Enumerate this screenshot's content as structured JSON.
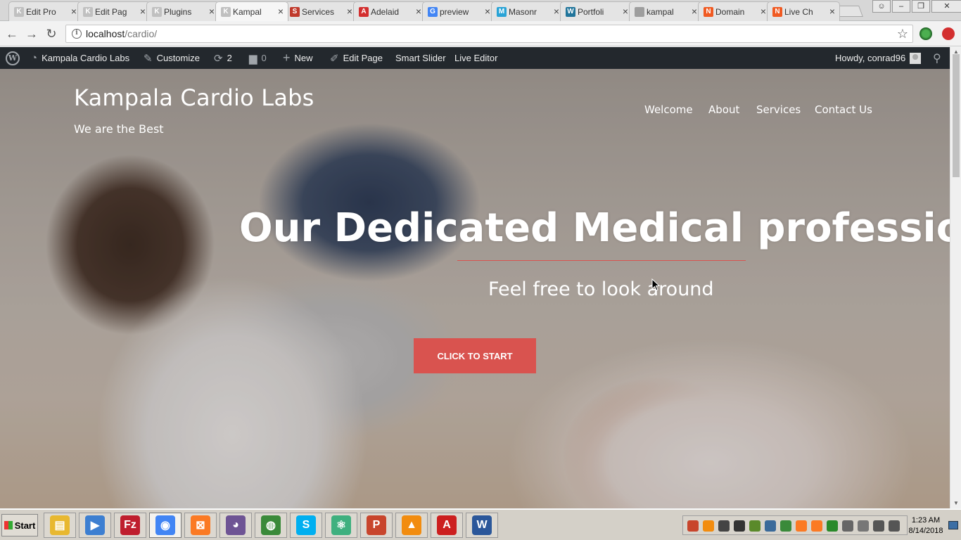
{
  "browser": {
    "tabs": [
      {
        "title": "Edit Pro",
        "favicon_color": "#c0c0c0",
        "favicon_glyph": "K"
      },
      {
        "title": "Edit Pag",
        "favicon_color": "#c0c0c0",
        "favicon_glyph": "K"
      },
      {
        "title": "Plugins",
        "favicon_color": "#c0c0c0",
        "favicon_glyph": "K"
      },
      {
        "title": "Kampal",
        "favicon_color": "#c0c0c0",
        "favicon_glyph": "K",
        "active": true
      },
      {
        "title": "Services",
        "favicon_color": "#c0392b",
        "favicon_glyph": "S"
      },
      {
        "title": "Adelaid",
        "favicon_color": "#d32f2f",
        "favicon_glyph": "A"
      },
      {
        "title": "preview",
        "favicon_color": "#4285f4",
        "favicon_glyph": "G"
      },
      {
        "title": "Masonr",
        "favicon_color": "#29a3d6",
        "favicon_glyph": "M"
      },
      {
        "title": "Portfoli",
        "favicon_color": "#21759b",
        "favicon_glyph": "W"
      },
      {
        "title": "kampal",
        "favicon_color": "#9e9e9e",
        "favicon_glyph": ""
      },
      {
        "title": "Domain",
        "favicon_color": "#f05a22",
        "favicon_glyph": "N"
      },
      {
        "title": "Live Ch",
        "favicon_color": "#f05a22",
        "favicon_glyph": "N"
      }
    ],
    "close_glyph": "×",
    "url_host": "localhost",
    "url_path": "/cardio/"
  },
  "adminbar": {
    "site_name": "Kampala Cardio Labs",
    "customize": "Customize",
    "updates_count": "2",
    "comments_count": "0",
    "new_label": "New",
    "edit_page": "Edit Page",
    "smart_slider": "Smart Slider",
    "live_editor": "Live Editor",
    "howdy": "Howdy, conrad96"
  },
  "site": {
    "title": "Kampala Cardio Labs",
    "tagline": "We are the Best",
    "nav": [
      "Welcome",
      "About",
      "Services",
      "Contact Us"
    ]
  },
  "hero": {
    "heading": "Our Dedicated Medical professionals",
    "subheading": "Feel free to look around",
    "cta": "CLICK TO START",
    "accent_color": "#d9534f"
  },
  "taskbar": {
    "start_label": "Start",
    "apps": [
      {
        "name": "file-explorer",
        "color": "#e8b830",
        "glyph": "▤"
      },
      {
        "name": "media-player",
        "color": "#3d7fd1",
        "glyph": "▶"
      },
      {
        "name": "filezilla",
        "color": "#bf1e2e",
        "glyph": "Fz"
      },
      {
        "name": "chrome",
        "color": "#4285f4",
        "glyph": "◉",
        "active": true
      },
      {
        "name": "xampp",
        "color": "#fb7a24",
        "glyph": "⊠"
      },
      {
        "name": "github",
        "color": "#6e5494",
        "glyph": "◕"
      },
      {
        "name": "network-globe",
        "color": "#3a8a3a",
        "glyph": "◍"
      },
      {
        "name": "skype",
        "color": "#00aff0",
        "glyph": "S"
      },
      {
        "name": "atom",
        "color": "#3fb07f",
        "glyph": "⚛"
      },
      {
        "name": "postman",
        "color": "#c8452c",
        "glyph": "P"
      },
      {
        "name": "vlc",
        "color": "#f28c0f",
        "glyph": "▲"
      },
      {
        "name": "acrobat",
        "color": "#cc1f1f",
        "glyph": "A"
      },
      {
        "name": "word",
        "color": "#2b579a",
        "glyph": "W"
      }
    ],
    "tray_icon_colors": [
      "#c8452c",
      "#f28c0f",
      "#444",
      "#333",
      "#5a8a2a",
      "#3a6a9a",
      "#3a8a3a",
      "#fb7a24",
      "#fb7a24",
      "#2a8a2a",
      "#666",
      "#777",
      "#555",
      "#555"
    ],
    "time": "1:23 AM",
    "date": "8/14/2018"
  }
}
